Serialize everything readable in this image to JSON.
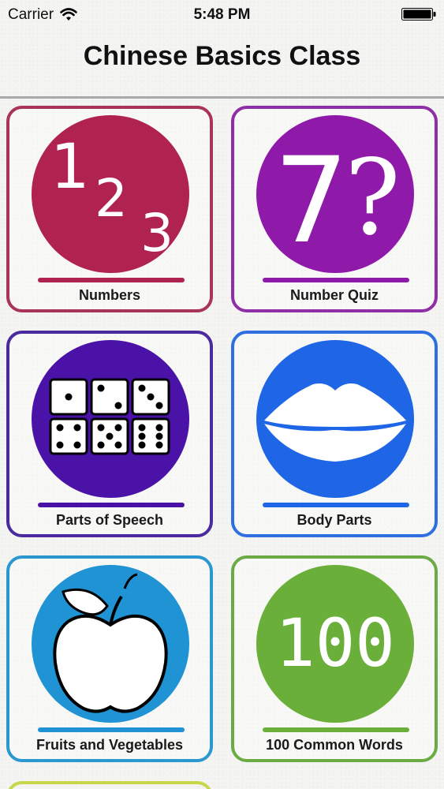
{
  "status_bar": {
    "carrier": "Carrier",
    "time": "5:48 PM"
  },
  "header": {
    "title": "Chinese Basics Class"
  },
  "tiles": [
    {
      "label": "Numbers",
      "color": "#b0224f",
      "border": "#a8345a",
      "icon": "numbers-123-icon"
    },
    {
      "label": "Number Quiz",
      "color": "#8f1aaa",
      "border": "#8e2fa8",
      "icon": "seven-question-icon"
    },
    {
      "label": "Parts of Speech",
      "color": "#4b12a8",
      "border": "#4b2a9e",
      "icon": "dice-icon"
    },
    {
      "label": "Body Parts",
      "color": "#1f66e6",
      "border": "#2f6fe0",
      "icon": "lips-icon"
    },
    {
      "label": "Fruits and Vegetables",
      "color": "#1f93d3",
      "border": "#2a97d0",
      "icon": "apple-icon"
    },
    {
      "label": "100 Common Words",
      "color": "#6aaf3a",
      "border": "#6cab43",
      "icon": "hundred-icon"
    }
  ],
  "partial_tile_color": "#c6d84a"
}
